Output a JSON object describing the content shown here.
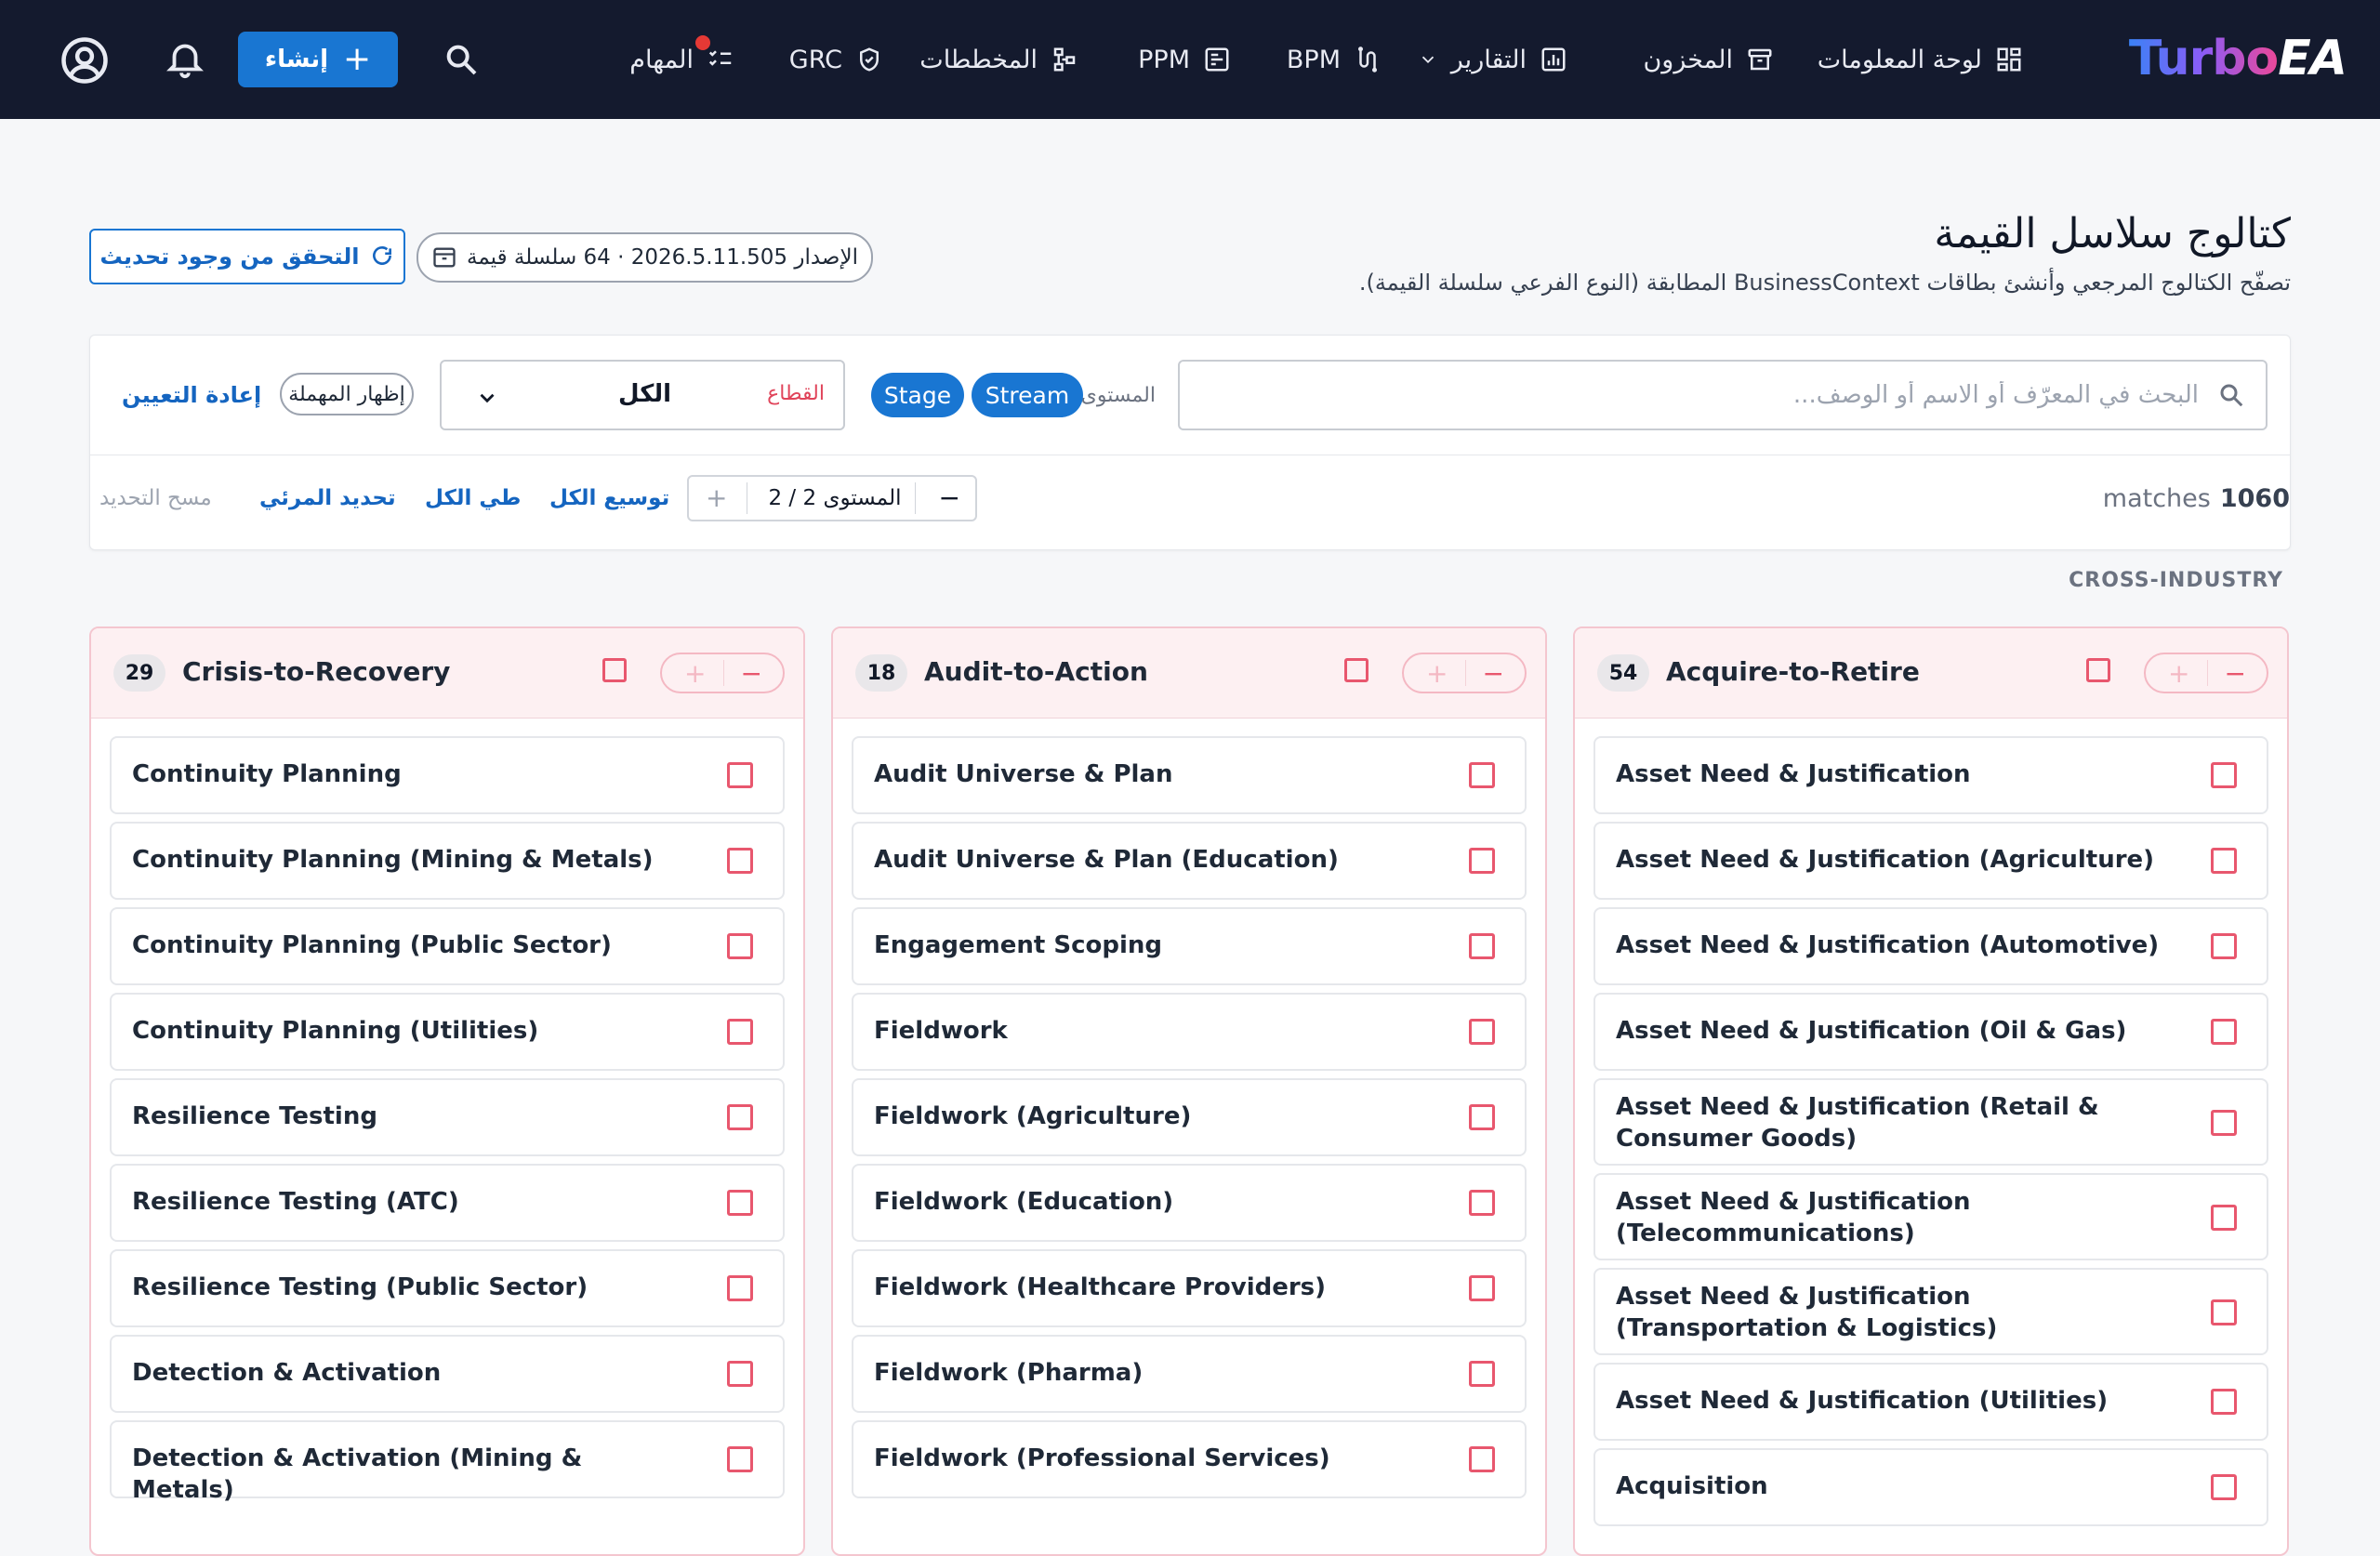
{
  "header": {
    "logo_main": "Turbo",
    "logo_accent": "EA",
    "nav": [
      {
        "label": "لوحة المعلومات",
        "icon": "dashboard-icon"
      },
      {
        "label": "المخزون",
        "icon": "inventory-icon"
      },
      {
        "label": "التقارير",
        "icon": "reports-icon"
      },
      {
        "label": "BPM",
        "icon": "bpm-icon"
      },
      {
        "label": "PPM",
        "icon": "ppm-icon"
      },
      {
        "label": "المخططات",
        "icon": "diagrams-icon"
      },
      {
        "label": "GRC",
        "icon": "grc-icon"
      },
      {
        "label": "المهام",
        "icon": "tasks-icon"
      }
    ],
    "create_label": "إنشاء"
  },
  "page": {
    "title": "كتالوج سلاسل القيمة",
    "subtitle": "تصفّح الكتالوج المرجعي وأنشئ بطاقات BusinessContext المطابقة (النوع الفرعي سلسلة القيمة).",
    "version_text": "الإصدار 2026.5.11.505 · 64 سلسلة قيمة",
    "check_updates": "التحقق من وجود تحديث"
  },
  "filters": {
    "search_placeholder": "البحث في المعرّف أو الاسم أو الوصف...",
    "level_label": "المستوى",
    "level_pills": [
      "Stream",
      "Stage"
    ],
    "sector_label": "القطاع",
    "sector_value": "الكل",
    "show_deprecated": "إظهار المهملة",
    "reset": "إعادة التعيين"
  },
  "toolbar": {
    "matches_count": "1060",
    "matches_label": "matches",
    "level_value": "المستوى 2 / 2",
    "expand_all": "توسيع الكل",
    "collapse_all": "طي الكل",
    "select_visible": "تحديد المرئي",
    "clear_selection": "مسح التحديد"
  },
  "section": {
    "label": "CROSS-INDUSTRY"
  },
  "colors": {
    "topbar": "#141a2e",
    "primary": "#1976d2",
    "accent_pink": "#e8576e"
  },
  "columns": [
    {
      "count": "29",
      "title": "Crisis-to-Recovery",
      "items": [
        "Continuity Planning",
        "Continuity Planning (Mining & Metals)",
        "Continuity Planning (Public Sector)",
        "Continuity Planning (Utilities)",
        "Resilience Testing",
        "Resilience Testing (ATC)",
        "Resilience Testing (Public Sector)",
        "Detection & Activation",
        "Detection & Activation (Mining & Metals)"
      ]
    },
    {
      "count": "18",
      "title": "Audit-to-Action",
      "items": [
        "Audit Universe & Plan",
        "Audit Universe & Plan (Education)",
        "Engagement Scoping",
        "Fieldwork",
        "Fieldwork (Agriculture)",
        "Fieldwork (Education)",
        "Fieldwork (Healthcare Providers)",
        "Fieldwork (Pharma)",
        "Fieldwork (Professional Services)"
      ]
    },
    {
      "count": "54",
      "title": "Acquire-to-Retire",
      "items": [
        "Asset Need & Justification",
        "Asset Need & Justification (Agriculture)",
        "Asset Need & Justification (Automotive)",
        "Asset Need & Justification (Oil & Gas)",
        "Asset Need & Justification (Retail & Consumer Goods)",
        "Asset Need & Justification (Telecommunications)",
        "Asset Need & Justification (Transportation & Logistics)",
        "Asset Need & Justification (Utilities)",
        "Acquisition"
      ]
    }
  ]
}
